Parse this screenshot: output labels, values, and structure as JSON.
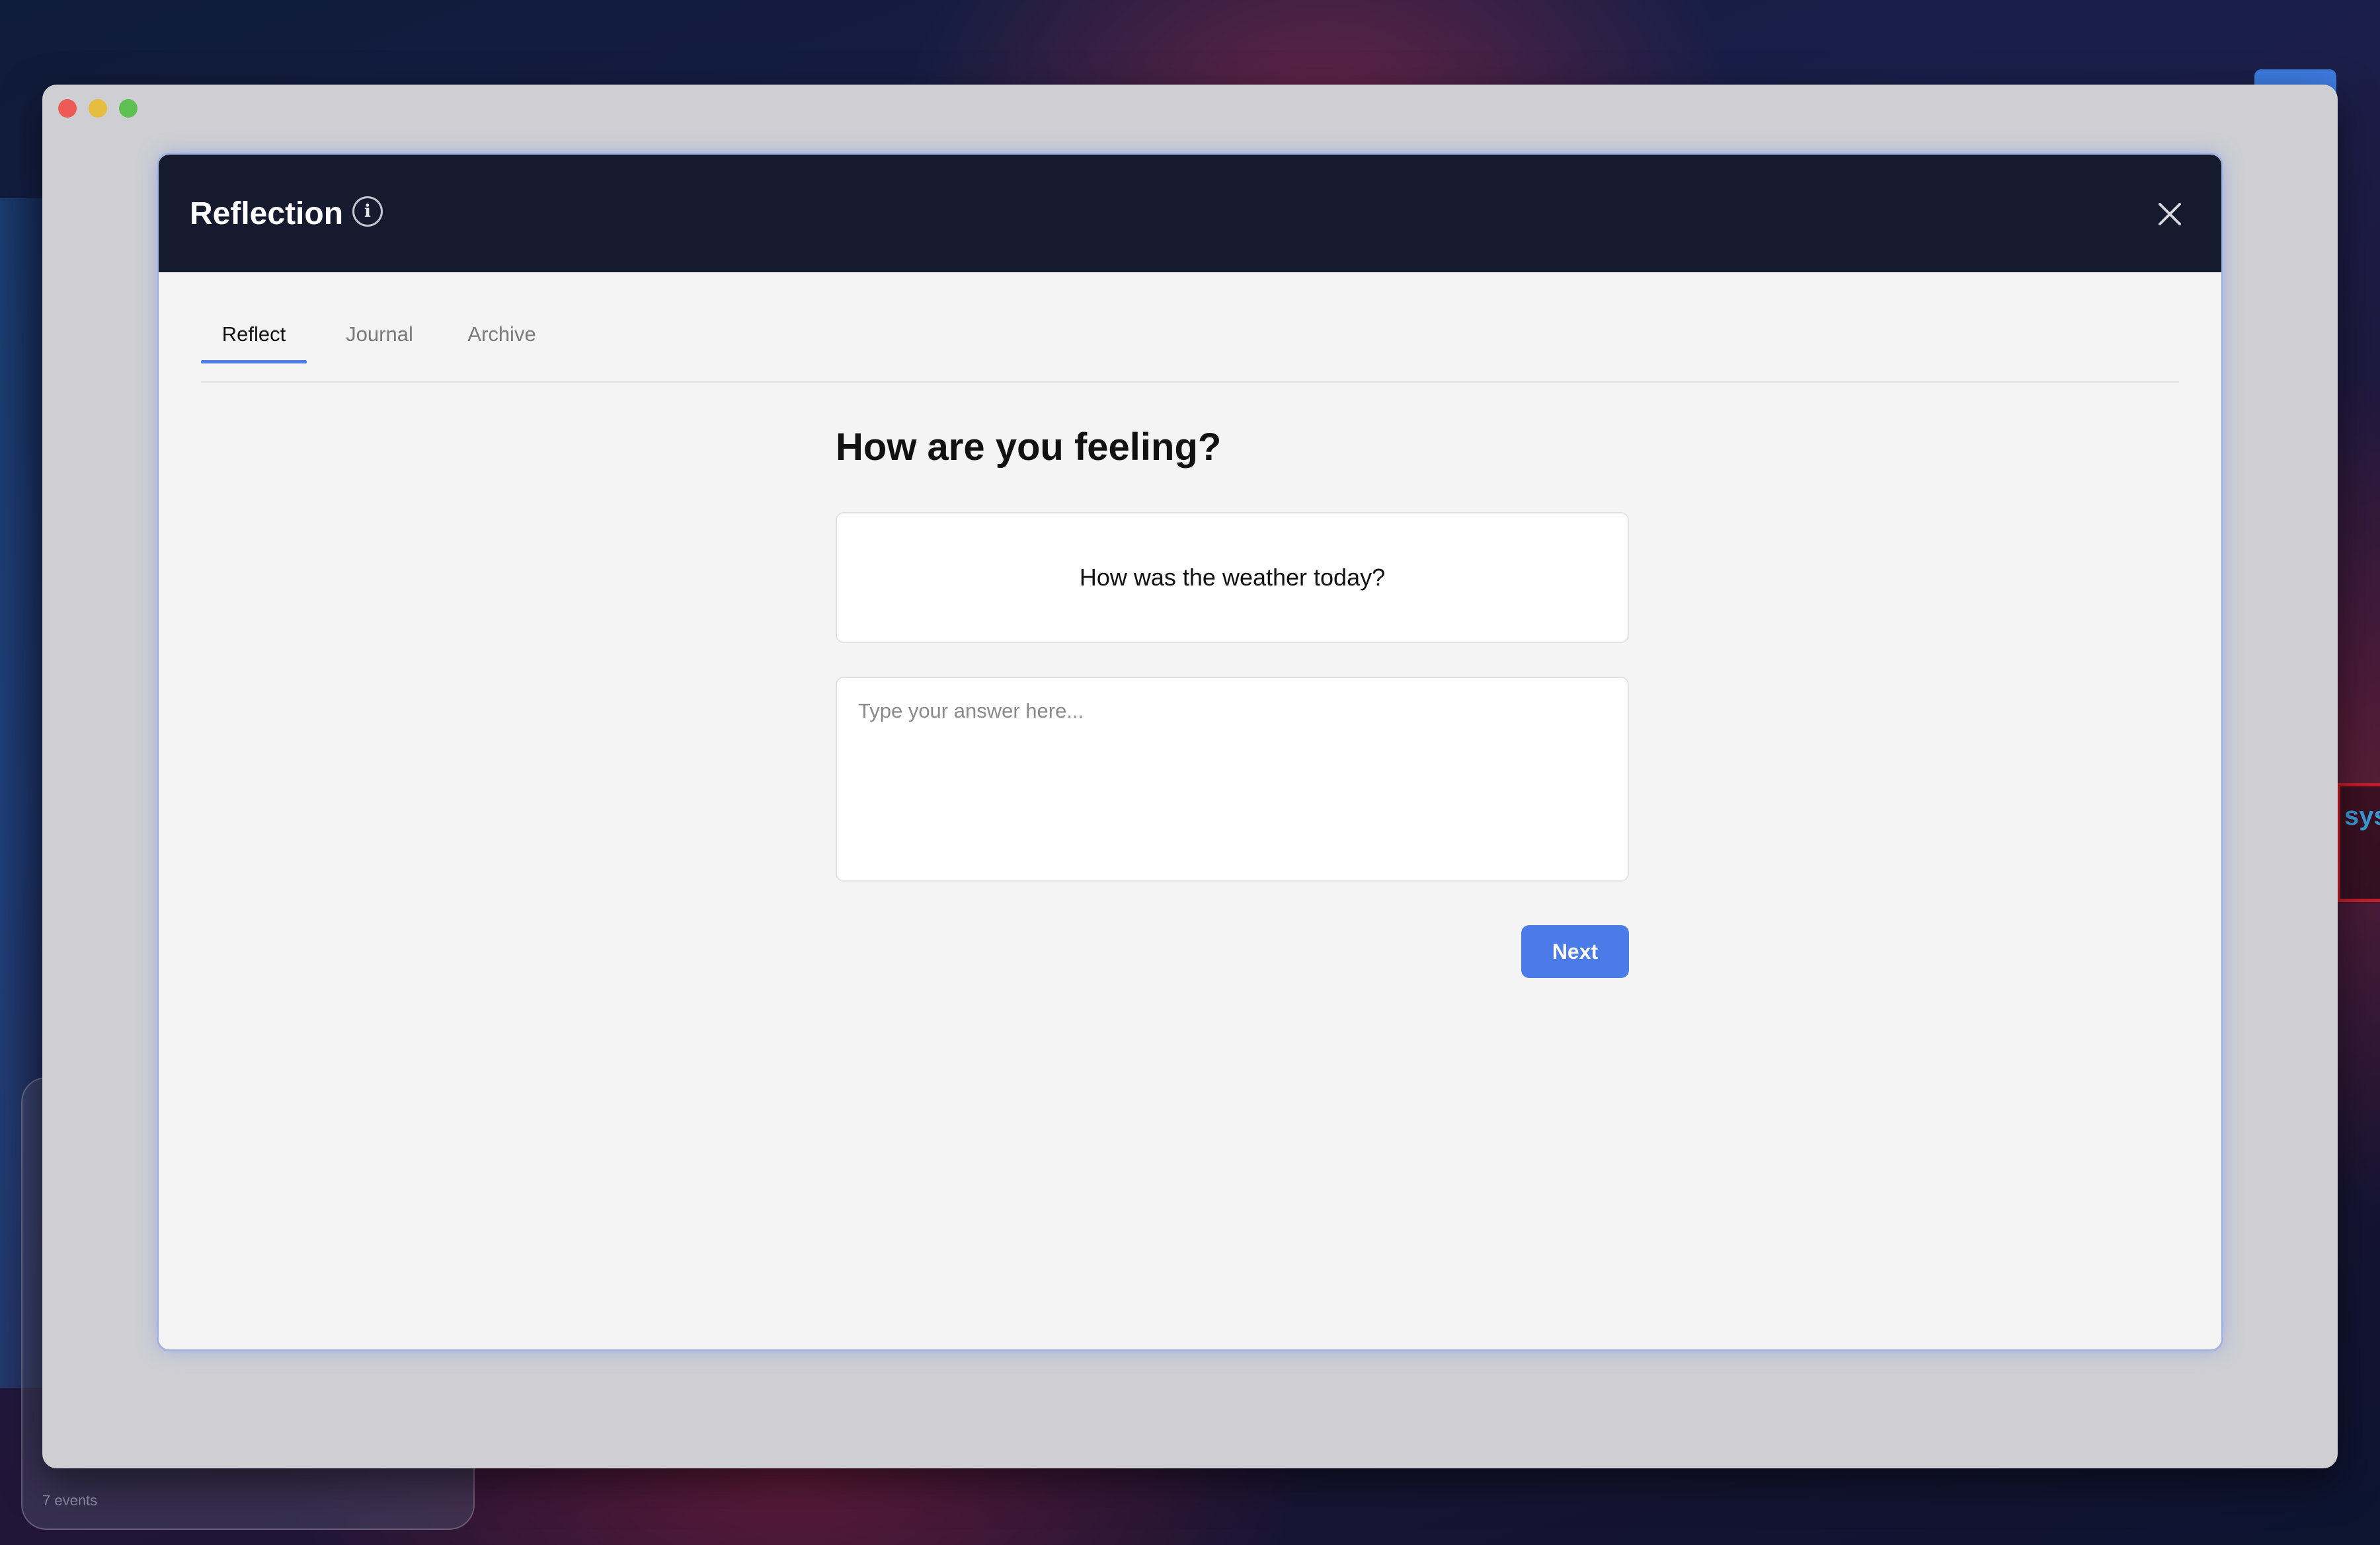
{
  "window": {
    "traffic_lights": [
      "close",
      "minimize",
      "zoom"
    ]
  },
  "modal": {
    "title": "Reflection",
    "info_icon_glyph": "i",
    "info_icon": "info-icon",
    "close_icon": "close-icon"
  },
  "tabs": [
    {
      "label": "Reflect",
      "active": true
    },
    {
      "label": "Journal",
      "active": false
    },
    {
      "label": "Archive",
      "active": false
    }
  ],
  "main": {
    "heading": "How are you feeling?",
    "prompt": "How was the weather today?",
    "answer": {
      "value": "",
      "placeholder": "Type your answer here..."
    },
    "next_label": "Next"
  },
  "desktop": {
    "panel_text": "7 events",
    "sign_text": "sys"
  },
  "colors": {
    "accent": "#4a7be8",
    "header_bg": "#151a2e",
    "modal_bg": "#f4f4f4"
  }
}
